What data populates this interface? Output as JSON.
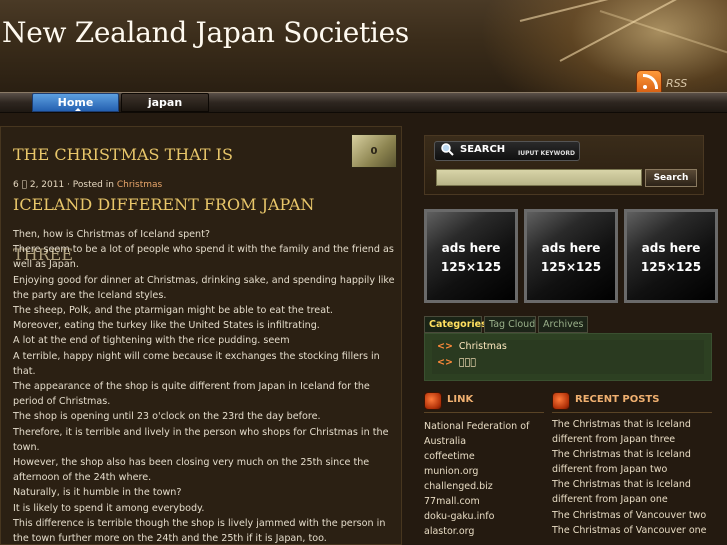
{
  "site": {
    "title": "New Zealand Japan Societies",
    "rss_label": "RSS"
  },
  "nav": {
    "items": [
      {
        "label": "Home",
        "active": true
      },
      {
        "label": "japan",
        "active": false
      }
    ]
  },
  "post": {
    "title_line1": "THE CHRISTMAS THAT IS",
    "title_line2": "ICELAND DIFFERENT FROM JAPAN",
    "title_line3": "THREE",
    "comment_count": "0",
    "date": "6 \u0000 2, 2011",
    "posted_in": "· Posted in",
    "category": "Christmas",
    "body": [
      "Then, how is Christmas of Iceland spent?",
      "There seem to be a lot of people who spend it with the family and the friend as well as Japan.",
      "Enjoying good for dinner at Christmas, drinking sake, and spending happily like the party are the Iceland styles.",
      "The sheep, Polk, and the ptarmigan might be able to eat the treat.",
      "Moreover, eating the turkey like the United States is infiltrating.",
      "A lot at the end of tightening with the rice pudding. seem",
      "A terrible, happy night will come because it exchanges the stocking fillers in that.",
      "The appearance of the shop is quite different from Japan in Iceland for the period of Christmas.",
      "The shop is opening until 23 o'clock on the 23rd the day before.",
      "Therefore, it is terrible and lively in the person who shops for Christmas in the town.",
      "However, the shop also has been closing very much on the 25th since the afternoon of the 24th where.",
      "Naturally, is it humble in the town?",
      "It is likely to spend it among everybody.",
      "This difference is terrible though the shop is lively jammed with the person in the town further more on the 24th and the 25th if it is Japan, too."
    ]
  },
  "search": {
    "label": "SEARCH",
    "hint": "IUPUT KEYWORD",
    "input_value": "",
    "button_label": "Search"
  },
  "ads": [
    {
      "line1": "ads here",
      "line2": "125×125"
    },
    {
      "line1": "ads here",
      "line2": "125×125"
    },
    {
      "line1": "ads here",
      "line2": "125×125"
    }
  ],
  "tabs": {
    "categories": "Categories",
    "tag_cloud": "Tag Cloud",
    "archives": "Archives"
  },
  "categories": [
    {
      "arrow": "<>",
      "label": "Christmas"
    },
    {
      "arrow": "<>",
      "label": "\u0000\u0000\u0000"
    }
  ],
  "link_widget": {
    "title": "LINK",
    "items": [
      "National Federation of",
      "Australia",
      "coffeetime",
      "munion.org",
      "challenged.biz",
      "77mall.com",
      "doku-gaku.info",
      "alastor.org"
    ]
  },
  "recent_widget": {
    "title": "RECENT POSTS",
    "items": [
      "The Christmas that is Iceland",
      "different from Japan three",
      "The Christmas that is Iceland",
      "different from Japan two",
      "The Christmas that is Iceland",
      "different from Japan one",
      "The Christmas of Vancouver two",
      "The Christmas of Vancouver one"
    ]
  }
}
